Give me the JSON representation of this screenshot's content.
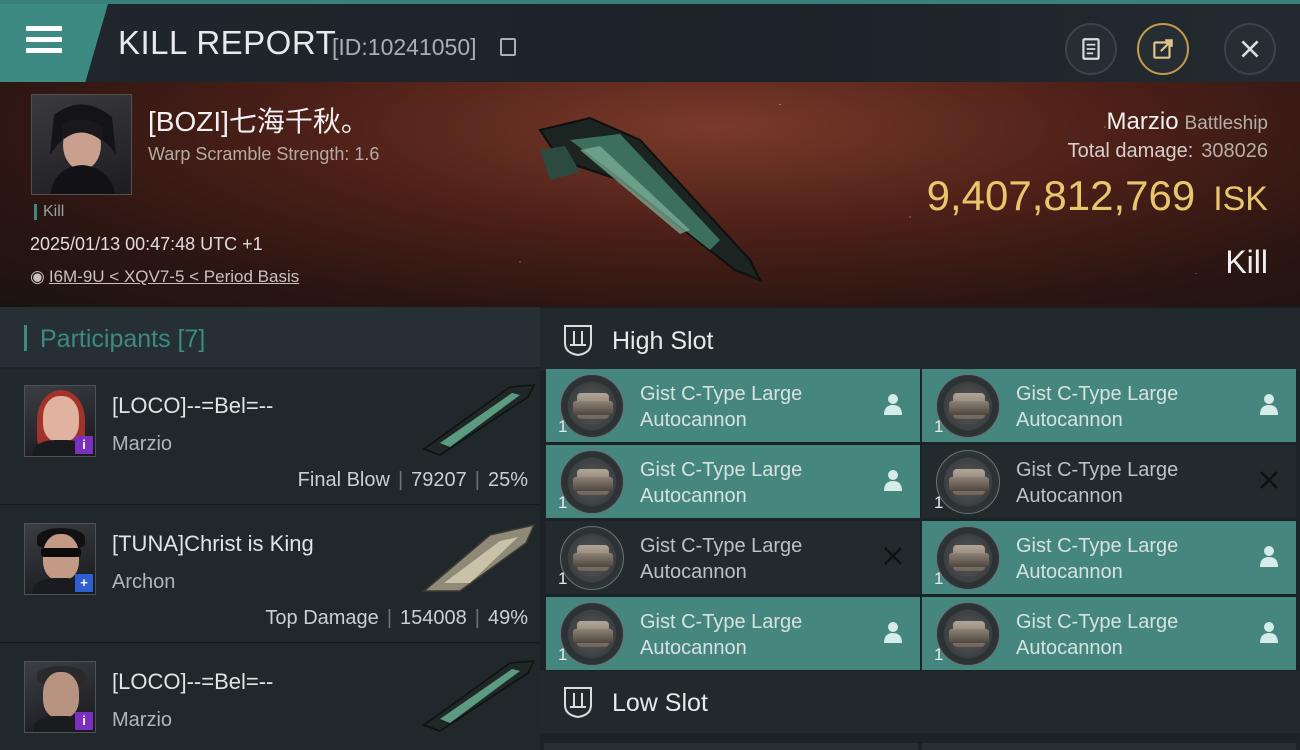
{
  "header": {
    "title": "KILL REPORT",
    "id_label": "[ID:10241050]",
    "icons": [
      "menu-icon",
      "clipboard-icon",
      "share-icon",
      "close-icon"
    ]
  },
  "victim": {
    "name": "[BOZI]七海千秋。",
    "scramble": "Warp Scramble Strength: 1.6",
    "tag": "Kill",
    "datetime": "2025/01/13 00:47:48 UTC +1",
    "location": "I6M-9U < XQV7-5 < Period Basis",
    "ship": "Marzio",
    "ship_class": "Battleship",
    "damage_label": "Total damage:",
    "damage_value": "308026",
    "isk_value": "9,407,812,769",
    "isk_unit": "ISK",
    "result": "Kill"
  },
  "participants": {
    "title": "Participants [7]",
    "rows": [
      {
        "name": "[LOCO]--=Bel=--",
        "ship": "Marzio",
        "role": "Final Blow",
        "damage": "79207",
        "percent": "25%"
      },
      {
        "name": "[TUNA]Christ is King",
        "ship": "Archon",
        "role": "Top Damage",
        "damage": "154008",
        "percent": "49%"
      },
      {
        "name": "[LOCO]--=Bel=--",
        "ship": "Marzio",
        "role": "",
        "damage": "",
        "percent": ""
      }
    ]
  },
  "fittings": {
    "high_slot_label": "High Slot",
    "low_slot_label": "Low Slot",
    "modules": [
      {
        "name": "Gist C-Type Large Autocannon",
        "qty": "1",
        "state": "teal",
        "action": "pilot-icon"
      },
      {
        "name": "Gist C-Type Large Autocannon",
        "qty": "1",
        "state": "teal",
        "action": "pilot-icon"
      },
      {
        "name": "Gist C-Type Large Autocannon",
        "qty": "1",
        "state": "teal",
        "action": "pilot-icon"
      },
      {
        "name": "Gist C-Type Large Autocannon",
        "qty": "1",
        "state": "dark",
        "action": "destroyed-icon"
      },
      {
        "name": "Gist C-Type Large Autocannon",
        "qty": "1",
        "state": "dark",
        "action": "destroyed-icon"
      },
      {
        "name": "Gist C-Type Large Autocannon",
        "qty": "1",
        "state": "teal",
        "action": "pilot-icon"
      },
      {
        "name": "Gist C-Type Large Autocannon",
        "qty": "1",
        "state": "teal",
        "action": "pilot-icon"
      },
      {
        "name": "Gist C-Type Large Autocannon",
        "qty": "1",
        "state": "teal",
        "action": "pilot-icon"
      }
    ]
  }
}
